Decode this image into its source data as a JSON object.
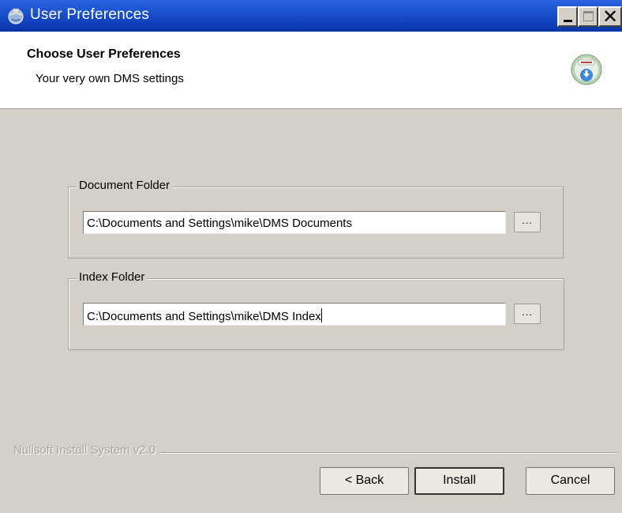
{
  "window": {
    "title": "User Preferences",
    "icon": "installer-globe-icon"
  },
  "header": {
    "title": "Choose User Preferences",
    "subtitle": "Your very own DMS settings",
    "icon": "install-disk-icon"
  },
  "document_folder": {
    "label": "Document Folder",
    "value": "C:\\Documents and Settings\\mike\\DMS Documents",
    "browse_label": "..."
  },
  "index_folder": {
    "label": "Index Folder",
    "value": "C:\\Documents and Settings\\mike\\DMS Index",
    "browse_label": "..."
  },
  "branding": "Nullsoft Install System v2.0",
  "buttons": {
    "back": "< Back",
    "install": "Install",
    "cancel": "Cancel"
  },
  "colors": {
    "titlebar": "#0f40b8",
    "dialog_bg": "#d4d0c8",
    "header_bg": "#ffffff"
  }
}
